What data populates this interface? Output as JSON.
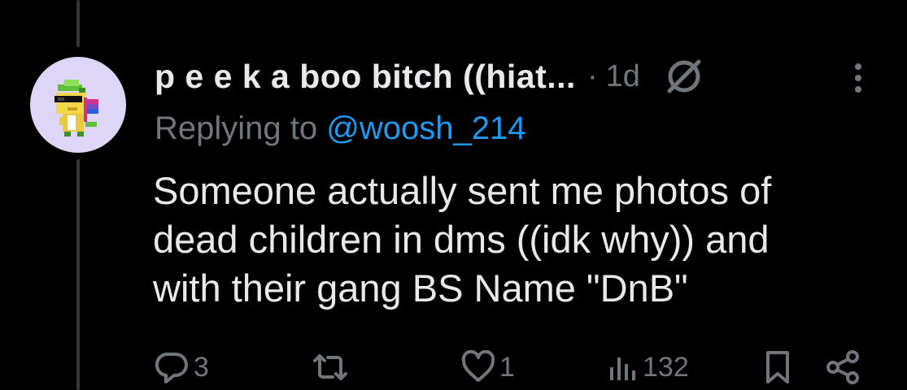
{
  "tweet": {
    "display_name": "p e e k a boo bitch ((hiat...",
    "separator": "·",
    "time": "1d",
    "replying_prefix": "Replying to ",
    "replying_handle": "@woosh_214",
    "text_lines": [
      "Someone actually sent me photos of",
      "dead children in dms ((idk why)) and",
      "with their gang BS Name \"DnB\""
    ]
  },
  "actions": {
    "reply_count": "3",
    "repost_count": "",
    "like_count": "1",
    "views_count": "132"
  },
  "icons": {
    "reply": "reply-icon",
    "repost": "repost-icon",
    "like": "heart-icon",
    "views": "analytics-icon",
    "bookmark": "bookmark-icon",
    "share": "share-icon",
    "more": "more-icon",
    "nonlink": "no-entry-icon"
  },
  "colors": {
    "background": "#000000",
    "text": "#e7e9ea",
    "muted": "#71767b",
    "link": "#1d9bf0",
    "avatar_bg": "#ddd6f7"
  }
}
